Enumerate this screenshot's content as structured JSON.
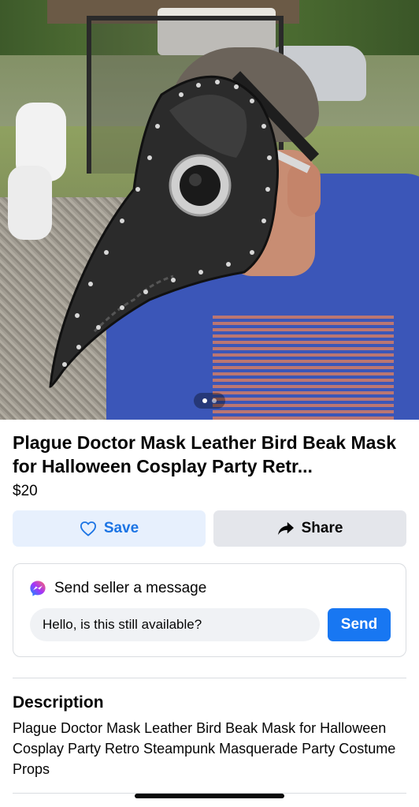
{
  "listing": {
    "title": "Plague Doctor Mask Leather Bird Beak Mask for Halloween Cosplay Party Retr...",
    "price": "$20",
    "photo_pagination": {
      "total": 2,
      "current": 1
    }
  },
  "actions": {
    "save_label": "Save",
    "save_icon": "heart-outline-icon",
    "share_label": "Share",
    "share_icon": "share-arrow-icon"
  },
  "message": {
    "heading": "Send seller a message",
    "icon": "messenger-icon",
    "input_value": "Hello, is this still available?",
    "send_label": "Send"
  },
  "description": {
    "heading": "Description",
    "body": "Plague Doctor Mask Leather Bird Beak Mask for Halloween Cosplay Party Retro Steampunk Masquerade Party Costume Props"
  },
  "colors": {
    "accent": "#1877f2",
    "save_bg": "#e7f0fd",
    "share_bg": "#e4e6eb",
    "input_bg": "#f0f2f5"
  }
}
